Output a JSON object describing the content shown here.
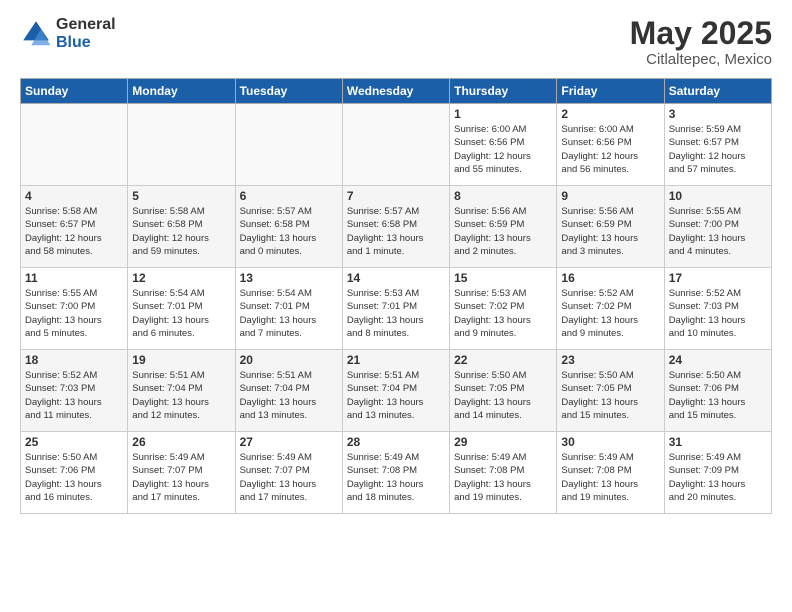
{
  "header": {
    "logo_general": "General",
    "logo_blue": "Blue",
    "month_title": "May 2025",
    "location": "Citlaltepec, Mexico"
  },
  "days_of_week": [
    "Sunday",
    "Monday",
    "Tuesday",
    "Wednesday",
    "Thursday",
    "Friday",
    "Saturday"
  ],
  "weeks": [
    [
      {
        "day": "",
        "info": ""
      },
      {
        "day": "",
        "info": ""
      },
      {
        "day": "",
        "info": ""
      },
      {
        "day": "",
        "info": ""
      },
      {
        "day": "1",
        "info": "Sunrise: 6:00 AM\nSunset: 6:56 PM\nDaylight: 12 hours\nand 55 minutes."
      },
      {
        "day": "2",
        "info": "Sunrise: 6:00 AM\nSunset: 6:56 PM\nDaylight: 12 hours\nand 56 minutes."
      },
      {
        "day": "3",
        "info": "Sunrise: 5:59 AM\nSunset: 6:57 PM\nDaylight: 12 hours\nand 57 minutes."
      }
    ],
    [
      {
        "day": "4",
        "info": "Sunrise: 5:58 AM\nSunset: 6:57 PM\nDaylight: 12 hours\nand 58 minutes."
      },
      {
        "day": "5",
        "info": "Sunrise: 5:58 AM\nSunset: 6:58 PM\nDaylight: 12 hours\nand 59 minutes."
      },
      {
        "day": "6",
        "info": "Sunrise: 5:57 AM\nSunset: 6:58 PM\nDaylight: 13 hours\nand 0 minutes."
      },
      {
        "day": "7",
        "info": "Sunrise: 5:57 AM\nSunset: 6:58 PM\nDaylight: 13 hours\nand 1 minute."
      },
      {
        "day": "8",
        "info": "Sunrise: 5:56 AM\nSunset: 6:59 PM\nDaylight: 13 hours\nand 2 minutes."
      },
      {
        "day": "9",
        "info": "Sunrise: 5:56 AM\nSunset: 6:59 PM\nDaylight: 13 hours\nand 3 minutes."
      },
      {
        "day": "10",
        "info": "Sunrise: 5:55 AM\nSunset: 7:00 PM\nDaylight: 13 hours\nand 4 minutes."
      }
    ],
    [
      {
        "day": "11",
        "info": "Sunrise: 5:55 AM\nSunset: 7:00 PM\nDaylight: 13 hours\nand 5 minutes."
      },
      {
        "day": "12",
        "info": "Sunrise: 5:54 AM\nSunset: 7:01 PM\nDaylight: 13 hours\nand 6 minutes."
      },
      {
        "day": "13",
        "info": "Sunrise: 5:54 AM\nSunset: 7:01 PM\nDaylight: 13 hours\nand 7 minutes."
      },
      {
        "day": "14",
        "info": "Sunrise: 5:53 AM\nSunset: 7:01 PM\nDaylight: 13 hours\nand 8 minutes."
      },
      {
        "day": "15",
        "info": "Sunrise: 5:53 AM\nSunset: 7:02 PM\nDaylight: 13 hours\nand 9 minutes."
      },
      {
        "day": "16",
        "info": "Sunrise: 5:52 AM\nSunset: 7:02 PM\nDaylight: 13 hours\nand 9 minutes."
      },
      {
        "day": "17",
        "info": "Sunrise: 5:52 AM\nSunset: 7:03 PM\nDaylight: 13 hours\nand 10 minutes."
      }
    ],
    [
      {
        "day": "18",
        "info": "Sunrise: 5:52 AM\nSunset: 7:03 PM\nDaylight: 13 hours\nand 11 minutes."
      },
      {
        "day": "19",
        "info": "Sunrise: 5:51 AM\nSunset: 7:04 PM\nDaylight: 13 hours\nand 12 minutes."
      },
      {
        "day": "20",
        "info": "Sunrise: 5:51 AM\nSunset: 7:04 PM\nDaylight: 13 hours\nand 13 minutes."
      },
      {
        "day": "21",
        "info": "Sunrise: 5:51 AM\nSunset: 7:04 PM\nDaylight: 13 hours\nand 13 minutes."
      },
      {
        "day": "22",
        "info": "Sunrise: 5:50 AM\nSunset: 7:05 PM\nDaylight: 13 hours\nand 14 minutes."
      },
      {
        "day": "23",
        "info": "Sunrise: 5:50 AM\nSunset: 7:05 PM\nDaylight: 13 hours\nand 15 minutes."
      },
      {
        "day": "24",
        "info": "Sunrise: 5:50 AM\nSunset: 7:06 PM\nDaylight: 13 hours\nand 15 minutes."
      }
    ],
    [
      {
        "day": "25",
        "info": "Sunrise: 5:50 AM\nSunset: 7:06 PM\nDaylight: 13 hours\nand 16 minutes."
      },
      {
        "day": "26",
        "info": "Sunrise: 5:49 AM\nSunset: 7:07 PM\nDaylight: 13 hours\nand 17 minutes."
      },
      {
        "day": "27",
        "info": "Sunrise: 5:49 AM\nSunset: 7:07 PM\nDaylight: 13 hours\nand 17 minutes."
      },
      {
        "day": "28",
        "info": "Sunrise: 5:49 AM\nSunset: 7:08 PM\nDaylight: 13 hours\nand 18 minutes."
      },
      {
        "day": "29",
        "info": "Sunrise: 5:49 AM\nSunset: 7:08 PM\nDaylight: 13 hours\nand 19 minutes."
      },
      {
        "day": "30",
        "info": "Sunrise: 5:49 AM\nSunset: 7:08 PM\nDaylight: 13 hours\nand 19 minutes."
      },
      {
        "day": "31",
        "info": "Sunrise: 5:49 AM\nSunset: 7:09 PM\nDaylight: 13 hours\nand 20 minutes."
      }
    ]
  ]
}
